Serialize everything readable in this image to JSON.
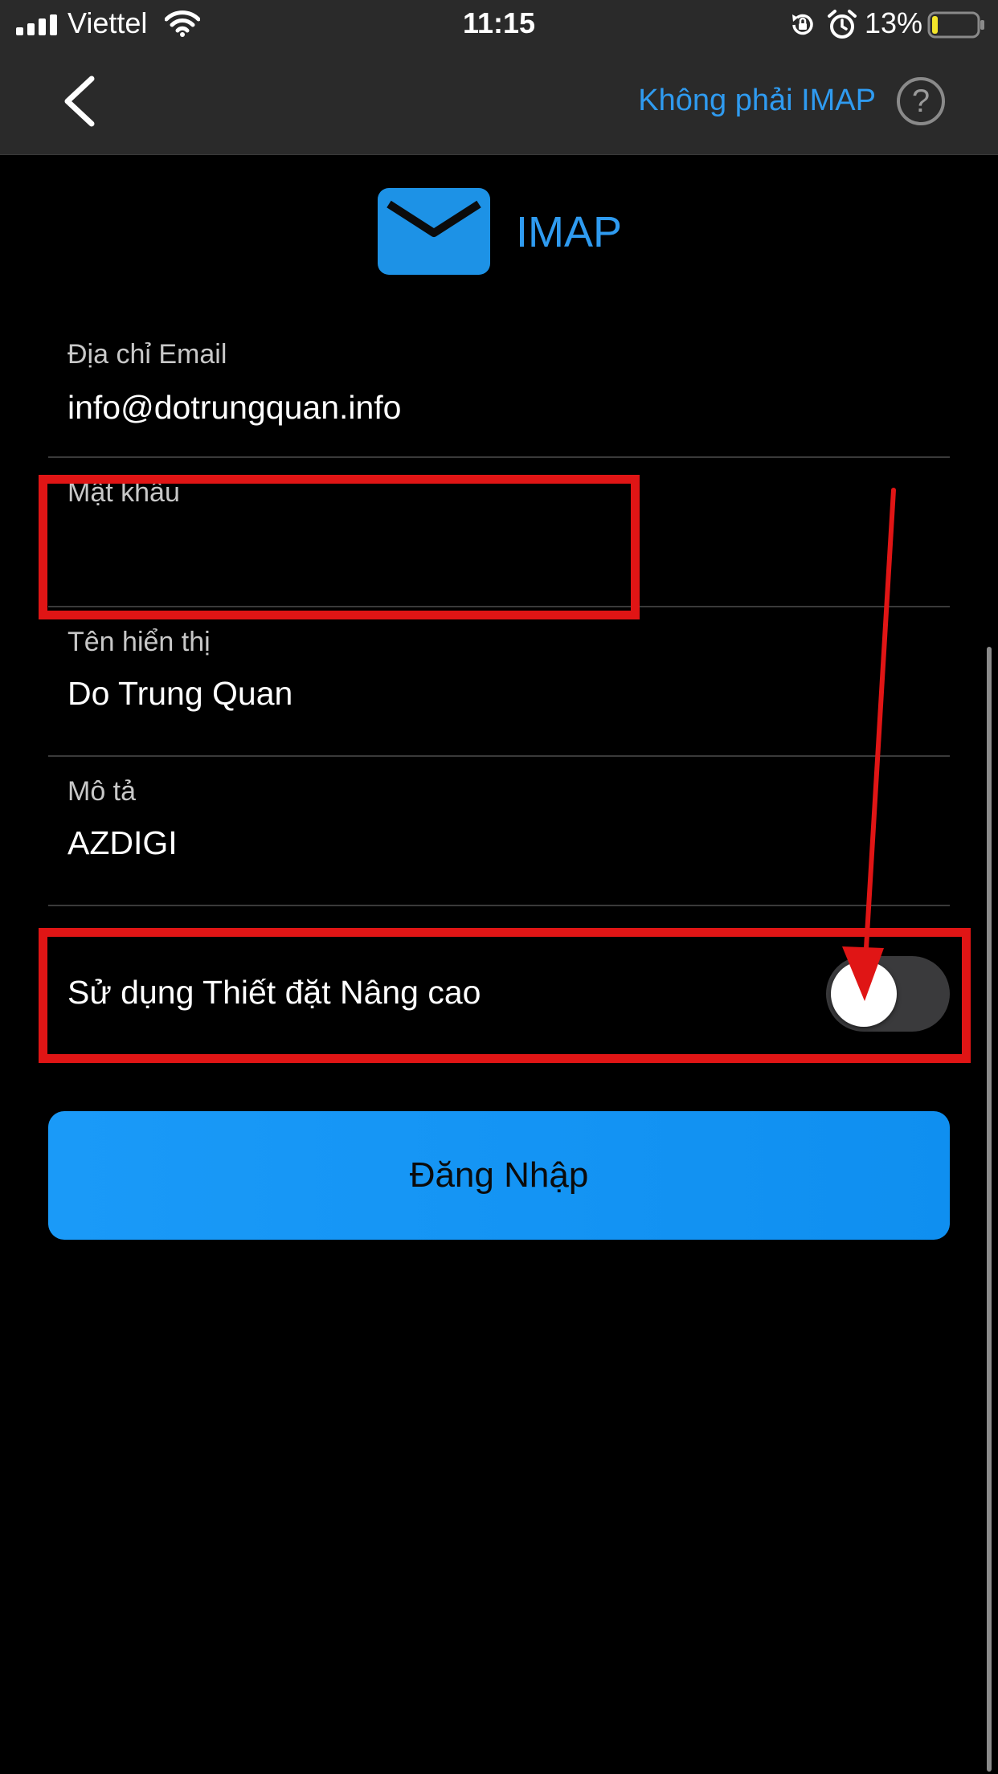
{
  "status_bar": {
    "carrier": "Viettel",
    "time": "11:15",
    "battery_percent": "13%",
    "battery_level": 0.13,
    "icons": [
      "signal-icon",
      "wifi-icon",
      "rotation-lock-icon",
      "alarm-icon",
      "battery-icon"
    ]
  },
  "nav": {
    "back_icon": "chevron-left-icon",
    "not_imap_label": "Không phải IMAP",
    "help_label": "?"
  },
  "header": {
    "logo_icon": "mail-envelope-icon",
    "title": "IMAP"
  },
  "form": {
    "email": {
      "label": "Địa chỉ Email",
      "value": "info@dotrungquan.info"
    },
    "password": {
      "label": "Mật khẩu",
      "value": ""
    },
    "display_name": {
      "label": "Tên hiển thị",
      "value": "Do Trung Quan"
    },
    "description": {
      "label": "Mô tả",
      "value": "AZDIGI"
    },
    "advanced": {
      "label": "Sử dụng Thiết đặt Nâng cao",
      "enabled": false
    }
  },
  "login_button": {
    "label": "Đăng Nhập"
  },
  "colors": {
    "accent": "#2f9bf0",
    "button": "#1a9af8",
    "annotation": "#e01515",
    "background": "#000000",
    "topbar": "#2a2a2a"
  }
}
